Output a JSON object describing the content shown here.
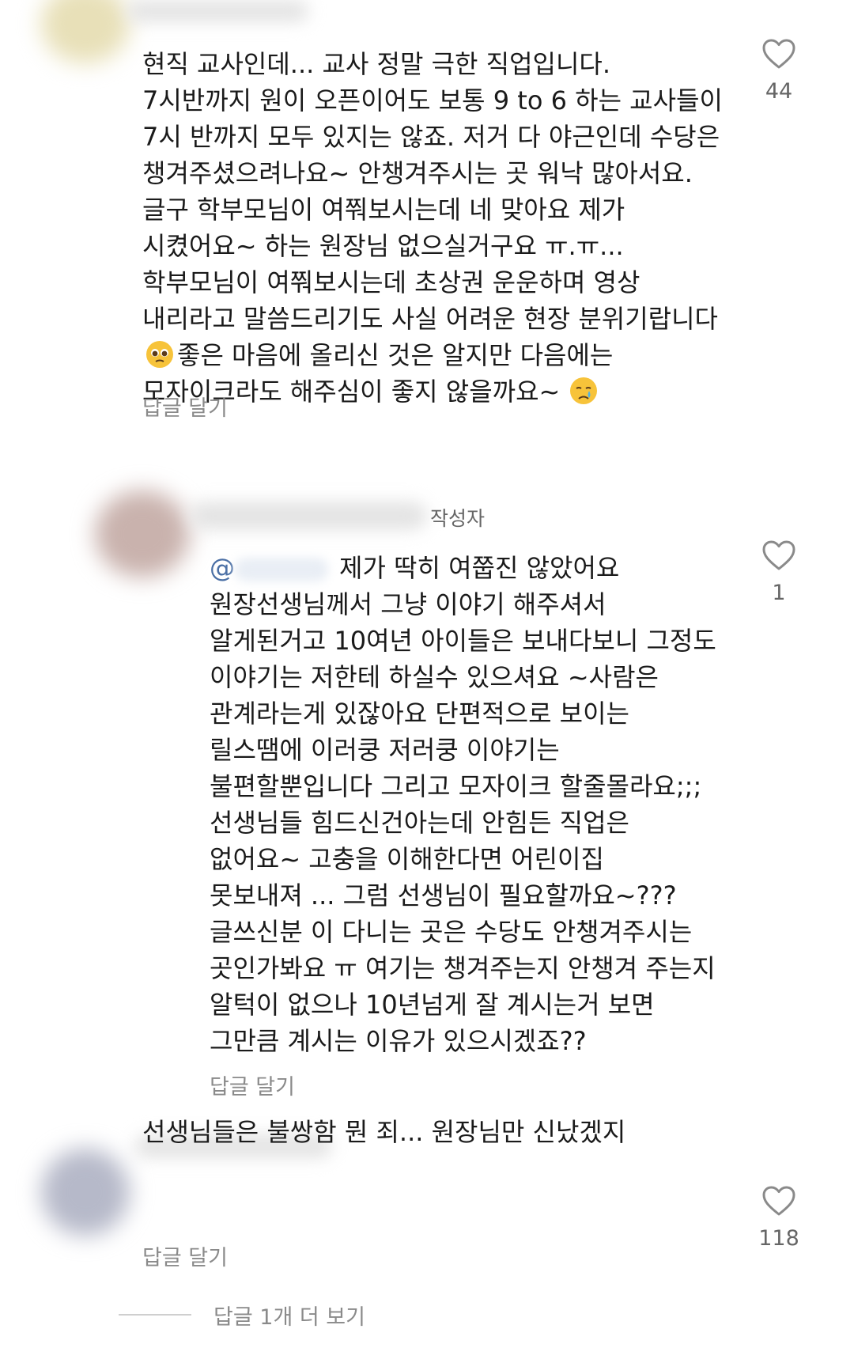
{
  "comments": [
    {
      "lines": [
        "현직 교사인데... 교사 정말 극한 직업입니다.",
        "7시반까지 원이 오픈이어도 보통 9 to 6 하는 교사들이",
        "7시 반까지 모두 있지는 않죠. 저거 다 야근인데 수당은",
        "챙겨주셨으려나요~ 안챙겨주시는 곳 워낙 많아서요.",
        "글구 학부모님이 여쭤보시는데 네 맞아요 제가",
        "시켰어요~ 하는 원장님 없으실거구요 ㅠ.ㅠ...",
        "학부모님이 여쭤보시는데 초상권 운운하며 영상",
        "내리라고 말씀드리기도 사실 어려운 현장 분위기랍니다",
        "좋은 마음에 올리신 것은 알지만 다음에는",
        "모자이크라도 해주심이 좋지 않을까요~"
      ],
      "reply_label": "답글 달기",
      "likes": "44"
    },
    {
      "author_badge": "작성자",
      "mention_prefix": "@",
      "lines": [
        "제가 딱히 여쭙진 않았어요",
        "원장선생님께서 그냥 이야기 해주셔서",
        "알게된거고 10여년 아이들은 보내다보니 그정도",
        "이야기는 저한테 하실수 있으셔요 ~사람은",
        "관계라는게 있잖아요 단편적으로 보이는",
        "릴스땜에 이러쿵 저러쿵 이야기는",
        "불편할뿐입니다 그리고 모자이크 할줄몰라요;;;",
        "선생님들 힘드신건아는데 안힘든 직업은",
        "없어요~ 고충을 이해한다면 어린이집",
        "못보내져 ... 그럼 선생님이 필요할까요~???",
        "글쓰신분 이 다니는 곳은 수당도 안챙겨주시는",
        "곳인가봐요 ㅠ 여기는 챙겨주는지 안챙겨 주는지",
        "알턱이 없으나 10년넘게 잘 계시는거 보면",
        "그만큼 계시는 이유가 있으시겠죠??"
      ],
      "reply_label": "답글 달기",
      "likes": "1"
    },
    {
      "lines": [
        "선생님들은 불쌍함 뭔 죄... 원장님만 신났겠지"
      ],
      "reply_label": "답글 달기",
      "likes": "118"
    }
  ],
  "more_replies_label": "답글 1개 더 보기",
  "colors": {
    "text": "#1a1a1a",
    "secondary": "#8a8a8a",
    "mention": "#4a6fa5",
    "heart_outline": "#8a8a8a"
  },
  "icons": {
    "like": "heart-outline-icon",
    "emoji_pleading": "pleading-face-emoji",
    "emoji_crying": "crying-face-emoji"
  }
}
